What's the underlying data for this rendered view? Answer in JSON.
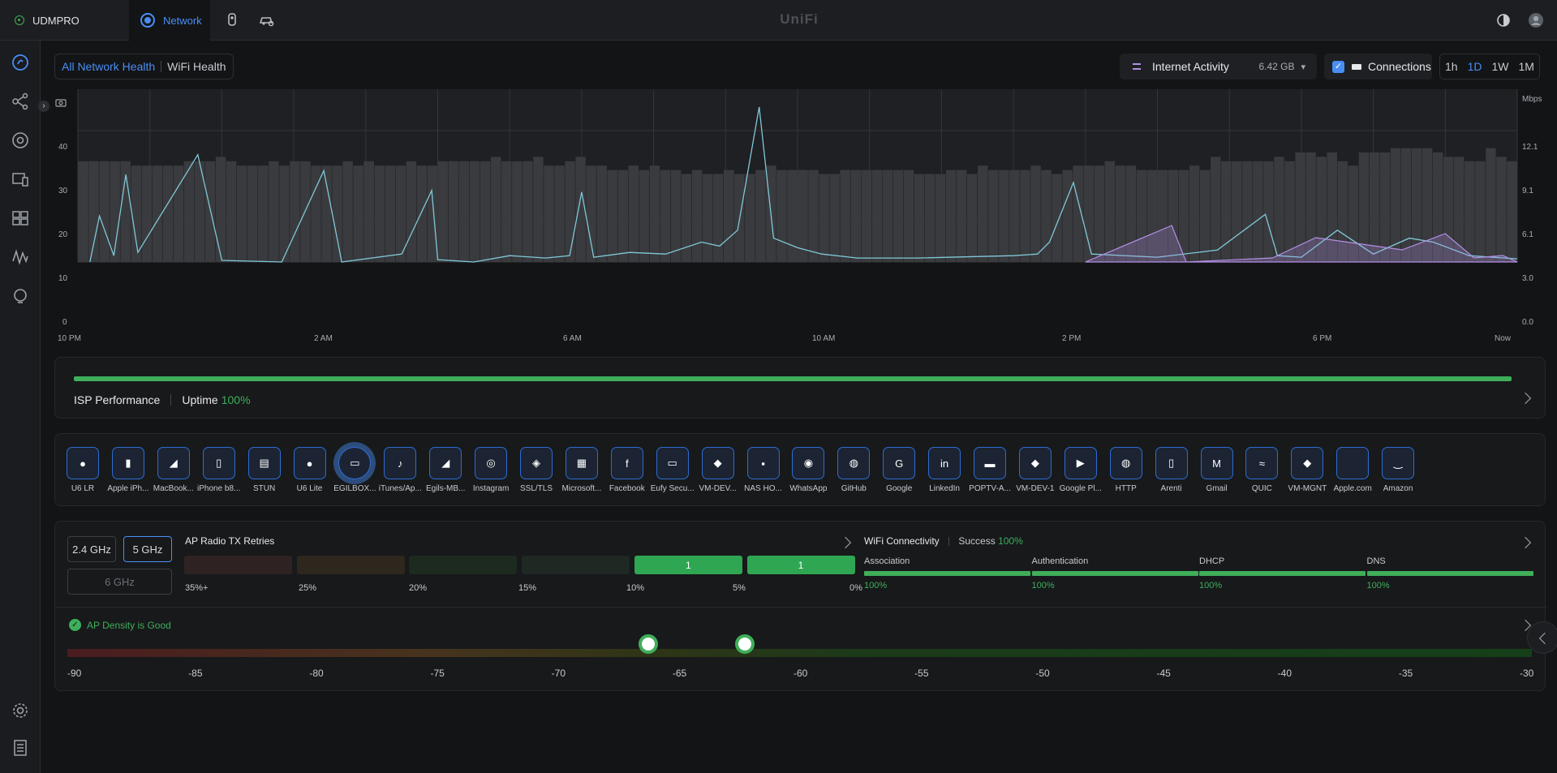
{
  "topbar": {
    "console_name": "UDMPRO",
    "active_app": "Network",
    "logo": "UniFi"
  },
  "tabs": {
    "all": "All Network Health",
    "wifi": "WiFi Health"
  },
  "internet_activity": {
    "label": "Internet Activity",
    "value": "6.42 GB"
  },
  "connections": {
    "label": "Connections",
    "checked": true
  },
  "time_range": {
    "options": [
      "1h",
      "1D",
      "1W",
      "1M"
    ],
    "selected": "1D"
  },
  "chart_data": {
    "type": "area",
    "x": [
      "10 PM",
      "2 AM",
      "6 AM",
      "10 AM",
      "2 PM",
      "6 PM",
      "Now"
    ],
    "y_left_ticks": [
      "0",
      "10",
      "20",
      "30",
      "40"
    ],
    "y_right_label": "Mbps",
    "y_right_ticks": [
      "0.0",
      "3.0",
      "6.1",
      "9.1",
      "12.1"
    ],
    "connections_bars": [
      23,
      23,
      23,
      23,
      23,
      22,
      22,
      22,
      22,
      22,
      23,
      23,
      23,
      24,
      23,
      22,
      22,
      22,
      23,
      22,
      23,
      23,
      22,
      22,
      22,
      23,
      22,
      23,
      22,
      22,
      22,
      23,
      22,
      22,
      23,
      23,
      23,
      23,
      23,
      24,
      23,
      23,
      23,
      24,
      22,
      22,
      23,
      24,
      22,
      22,
      21,
      21,
      22,
      21,
      22,
      21,
      21,
      20,
      21,
      20,
      20,
      21,
      20,
      20,
      21,
      22,
      21,
      21,
      21,
      21,
      20,
      20,
      21,
      21,
      21,
      21,
      21,
      21,
      21,
      20,
      20,
      20,
      21,
      21,
      20,
      22,
      21,
      21,
      21,
      21,
      22,
      21,
      20,
      21,
      22,
      22,
      22,
      23,
      22,
      22,
      21,
      21,
      21,
      21,
      21,
      22,
      21,
      24,
      23,
      23,
      23,
      23,
      23,
      24,
      23,
      25,
      25,
      24,
      25,
      23,
      22,
      25,
      25,
      25,
      26,
      26,
      26,
      26,
      25,
      24,
      24,
      23,
      23,
      26,
      24,
      23
    ],
    "series": [
      {
        "name": "Internet Activity",
        "color": "#7fc9d9"
      },
      {
        "name": "Connections",
        "color": "#b48ee8"
      }
    ]
  },
  "isp": {
    "label": "ISP Performance",
    "uptime_label": "Uptime",
    "uptime_value": "100%"
  },
  "apps": [
    {
      "name": "U6 LR",
      "icon": "●"
    },
    {
      "name": "Apple iPh...",
      "icon": "▮"
    },
    {
      "name": "MacBook...",
      "icon": "◢"
    },
    {
      "name": "iPhone b8...",
      "icon": "▯"
    },
    {
      "name": "STUN",
      "icon": "▤"
    },
    {
      "name": "U6 Lite",
      "icon": "●"
    },
    {
      "name": "EGILBOX...",
      "icon": "▭"
    },
    {
      "name": "iTunes/Ap...",
      "icon": "♪"
    },
    {
      "name": "Egils-MB...",
      "icon": "◢"
    },
    {
      "name": "Instagram",
      "icon": "◎"
    },
    {
      "name": "SSL/TLS",
      "icon": "◈"
    },
    {
      "name": "Microsoft...",
      "icon": "▦"
    },
    {
      "name": "Facebook",
      "icon": "f"
    },
    {
      "name": "Eufy Secu...",
      "icon": "▭"
    },
    {
      "name": "VM-DEV...",
      "icon": "◆"
    },
    {
      "name": "NAS HO...",
      "icon": "▪"
    },
    {
      "name": "WhatsApp",
      "icon": "◉"
    },
    {
      "name": "GitHub",
      "icon": "◍"
    },
    {
      "name": "Google",
      "icon": "G"
    },
    {
      "name": "LinkedIn",
      "icon": "in"
    },
    {
      "name": "POPTV-A...",
      "icon": "▬"
    },
    {
      "name": "VM-DEV-1",
      "icon": "◆"
    },
    {
      "name": "Google Pl...",
      "icon": "▶"
    },
    {
      "name": "HTTP",
      "icon": "◍"
    },
    {
      "name": "Arenti",
      "icon": "▯"
    },
    {
      "name": "Gmail",
      "icon": "M"
    },
    {
      "name": "QUIC",
      "icon": "≈"
    },
    {
      "name": "VM-MGNT",
      "icon": "◆"
    },
    {
      "name": "Apple.com",
      "icon": ""
    },
    {
      "name": "Amazon",
      "icon": "‿"
    }
  ],
  "bands": {
    "b24": "2.4 GHz",
    "b5": "5 GHz",
    "b6": "6 GHz"
  },
  "ap_retries": {
    "title": "AP Radio TX Retries",
    "buckets": [
      {
        "label": "35%+",
        "value": "",
        "color": "#2f2222"
      },
      {
        "label": "25%",
        "value": "",
        "color": "#2e271d"
      },
      {
        "label": "20%",
        "value": "",
        "color": "#1d2a20"
      },
      {
        "label": "15%",
        "value": "",
        "color": "#1f2823"
      },
      {
        "label": "10%",
        "value": "1",
        "color": "#2ea652"
      },
      {
        "label": "5%",
        "value": "1",
        "color": "#2ea652"
      }
    ],
    "end_label": "0%"
  },
  "wifi_connectivity": {
    "title": "WiFi Connectivity",
    "success_label": "Success",
    "success_value": "100%",
    "stages": [
      {
        "name": "Association",
        "value": "100%"
      },
      {
        "name": "Authentication",
        "value": "100%"
      },
      {
        "name": "DHCP",
        "value": "100%"
      },
      {
        "name": "DNS",
        "value": "100%"
      }
    ]
  },
  "ap_density": {
    "status": "AP Density is Good",
    "scale": [
      "-90",
      "-85",
      "-80",
      "-75",
      "-70",
      "-65",
      "-60",
      "-55",
      "-50",
      "-45",
      "-40",
      "-35",
      "-30"
    ],
    "markers_dbm": [
      -66,
      -62
    ]
  }
}
